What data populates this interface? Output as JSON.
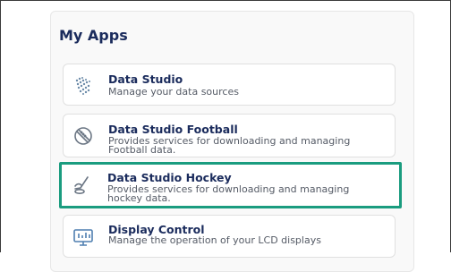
{
  "panel": {
    "title": "My Apps"
  },
  "apps": [
    {
      "title": "Data Studio",
      "description": "Manage your data sources",
      "icon": "data-studio-icon"
    },
    {
      "title": "Data Studio Football",
      "description": "Provides services for downloading and managing Football data.",
      "icon": "football-icon"
    },
    {
      "title": "Data Studio Hockey",
      "description": "Provides services for downloading and managing hockey data.",
      "icon": "hockey-icon",
      "selected": true
    },
    {
      "title": "Display Control",
      "description": "Manage the operation of your LCD displays",
      "icon": "display-control-icon"
    }
  ],
  "colors": {
    "title": "#1a2b5c",
    "selection": "#1a9c7f",
    "icon": "#6b7684"
  }
}
